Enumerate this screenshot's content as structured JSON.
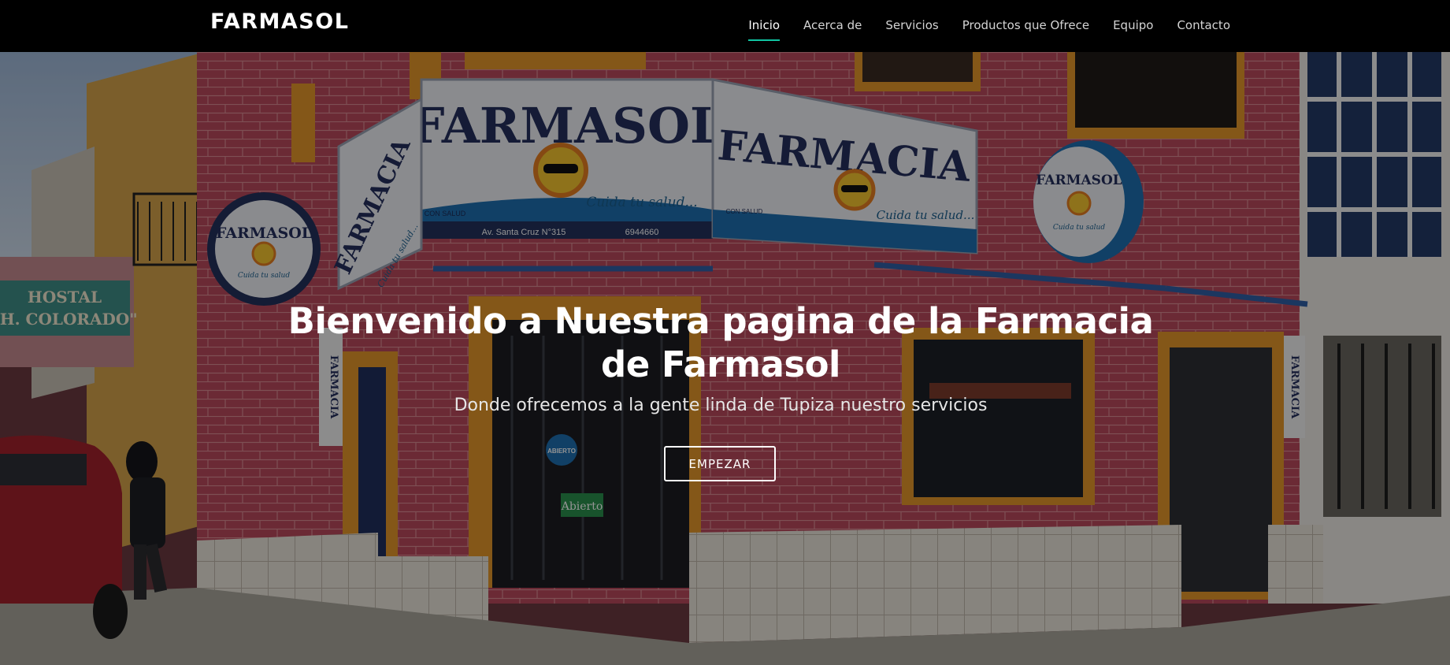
{
  "brand": "FARMASOL",
  "nav": {
    "items": [
      "Inicio",
      "Acerca de",
      "Servicios",
      "Productos que Ofrece",
      "Equipo",
      "Contacto"
    ],
    "active": "Inicio",
    "accent_color": "#10c5a2"
  },
  "hero": {
    "title": "Bienvenido a Nuestra pagina de la Farmacia de Farmasol",
    "subtitle": "Donde ofrecemos a la gente linda de Tupiza nuestro servicios",
    "button_label": "EMPEZAR"
  },
  "scene": {
    "main_sign": "FARMASOL",
    "main_sign_tagline": "Cuida tu salud...",
    "main_sign_address": "Av. Santa Cruz N°315",
    "main_sign_phone": "6944660",
    "right_sign": "FARMACIA",
    "right_sign_tagline": "Cuida tu salud...",
    "left_sign": "FARMACIA",
    "left_sign_tagline": "Cuida tu salud...",
    "round_sign_left": "FARMASOL",
    "round_sign_left_tagline": "Cuida tu salud",
    "round_sign_right": "FARMASOL",
    "round_sign_right_tagline": "Cuida tu salud",
    "hostal_sign_line1": "HOSTAL",
    "hostal_sign_line2": "\"H. COLORADO\"",
    "door_sticker": "ABIERTO",
    "door_sign": "Abierto",
    "inti_label": "INTI",
    "con_salud_label": "CON SALUD",
    "vertical_sign_left": "FARMACIA",
    "vertical_sign_right": "FARMACIA",
    "wall_color": "#b94a5c",
    "trim_color": "#e3962a"
  }
}
